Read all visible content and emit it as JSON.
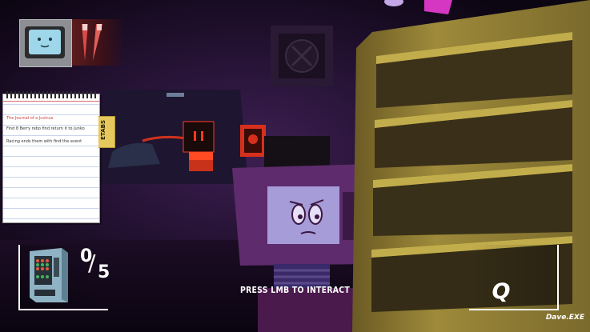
{
  "hud": {
    "portraits": [
      {
        "icon": "tv-head-character-icon",
        "highlight": "#8d8f95"
      },
      {
        "icon": "pencil-character-icon",
        "highlight": "#5c1c1c"
      }
    ],
    "journal": {
      "title": "The Journal of a Jusinus",
      "entries": [
        "Find 8 Berry rebo find return it to Junko",
        "Racing ends them with find the event"
      ],
      "tab_label": "ETABS"
    },
    "collectible": {
      "icon": "vending-machine-icon",
      "collected": "0",
      "slash": "/",
      "total": "5"
    },
    "prompt": "PRESS LMB TO INTERACT",
    "ability": {
      "key": "Q"
    },
    "player_name": "Dave.EXE"
  },
  "colors": {
    "ambient": "#12081c",
    "tv_body": "#5e2b6c",
    "tv_screen": "#a69cd7",
    "red_glow": "#ff3b1f",
    "shelf": "#c2ad4c",
    "hud_white": "#ffffff"
  }
}
